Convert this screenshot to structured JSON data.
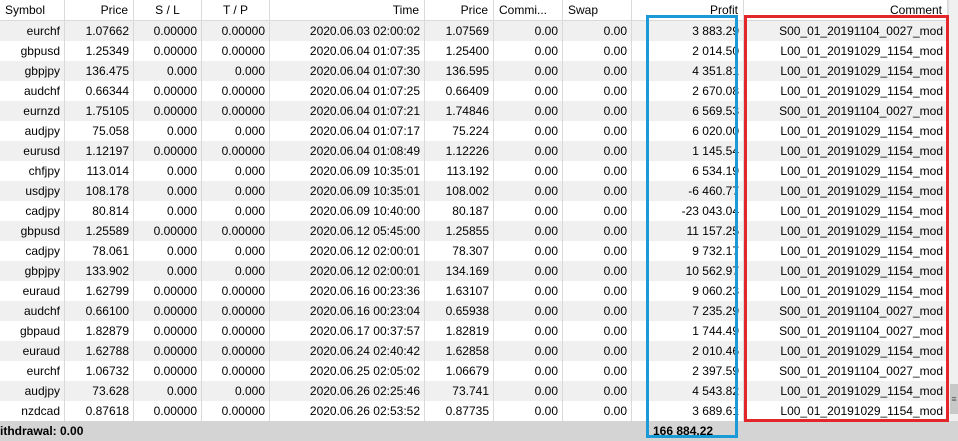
{
  "columns": [
    "Symbol",
    "Price",
    "S / L",
    "T / P",
    "Time",
    "Price",
    "Commi...",
    "Swap",
    "Profit",
    "Comment"
  ],
  "rows": [
    [
      "eurchf",
      "1.07662",
      "0.00000",
      "0.00000",
      "2020.06.03 02:00:02",
      "1.07569",
      "0.00",
      "0.00",
      "3 883.29",
      "S00_01_20191104_0027_mod"
    ],
    [
      "gbpusd",
      "1.25349",
      "0.00000",
      "0.00000",
      "2020.06.04 01:07:35",
      "1.25400",
      "0.00",
      "0.00",
      "2 014.50",
      "L00_01_20191029_1154_mod"
    ],
    [
      "gbpjpy",
      "136.475",
      "0.000",
      "0.000",
      "2020.06.04 01:07:30",
      "136.595",
      "0.00",
      "0.00",
      "4 351.81",
      "L00_01_20191029_1154_mod"
    ],
    [
      "audchf",
      "0.66344",
      "0.00000",
      "0.00000",
      "2020.06.04 01:07:25",
      "0.66409",
      "0.00",
      "0.00",
      "2 670.08",
      "L00_01_20191029_1154_mod"
    ],
    [
      "eurnzd",
      "1.75105",
      "0.00000",
      "0.00000",
      "2020.06.04 01:07:21",
      "1.74846",
      "0.00",
      "0.00",
      "6 569.53",
      "S00_01_20191104_0027_mod"
    ],
    [
      "audjpy",
      "75.058",
      "0.000",
      "0.000",
      "2020.06.04 01:07:17",
      "75.224",
      "0.00",
      "0.00",
      "6 020.00",
      "L00_01_20191029_1154_mod"
    ],
    [
      "eurusd",
      "1.12197",
      "0.00000",
      "0.00000",
      "2020.06.04 01:08:49",
      "1.12226",
      "0.00",
      "0.00",
      "1 145.54",
      "L00_01_20191029_1154_mod"
    ],
    [
      "chfjpy",
      "113.014",
      "0.000",
      "0.000",
      "2020.06.09 10:35:01",
      "113.192",
      "0.00",
      "0.00",
      "6 534.19",
      "L00_01_20191029_1154_mod"
    ],
    [
      "usdjpy",
      "108.178",
      "0.000",
      "0.000",
      "2020.06.09 10:35:01",
      "108.002",
      "0.00",
      "0.00",
      "-6 460.77",
      "L00_01_20191029_1154_mod"
    ],
    [
      "cadjpy",
      "80.814",
      "0.000",
      "0.000",
      "2020.06.09 10:40:00",
      "80.187",
      "0.00",
      "0.00",
      "-23 043.04",
      "L00_01_20191029_1154_mod"
    ],
    [
      "gbpusd",
      "1.25589",
      "0.00000",
      "0.00000",
      "2020.06.12 05:45:00",
      "1.25855",
      "0.00",
      "0.00",
      "11 157.25",
      "L00_01_20191029_1154_mod"
    ],
    [
      "cadjpy",
      "78.061",
      "0.000",
      "0.000",
      "2020.06.12 02:00:01",
      "78.307",
      "0.00",
      "0.00",
      "9 732.17",
      "L00_01_20191029_1154_mod"
    ],
    [
      "gbpjpy",
      "133.902",
      "0.000",
      "0.000",
      "2020.06.12 02:00:01",
      "134.169",
      "0.00",
      "0.00",
      "10 562.97",
      "L00_01_20191029_1154_mod"
    ],
    [
      "euraud",
      "1.62799",
      "0.00000",
      "0.00000",
      "2020.06.16 00:23:36",
      "1.63107",
      "0.00",
      "0.00",
      "9 060.23",
      "L00_01_20191029_1154_mod"
    ],
    [
      "audchf",
      "0.66100",
      "0.00000",
      "0.00000",
      "2020.06.16 00:23:04",
      "0.65938",
      "0.00",
      "0.00",
      "7 235.29",
      "S00_01_20191104_0027_mod"
    ],
    [
      "gbpaud",
      "1.82879",
      "0.00000",
      "0.00000",
      "2020.06.17 00:37:57",
      "1.82819",
      "0.00",
      "0.00",
      "1 744.49",
      "S00_01_20191104_0027_mod"
    ],
    [
      "euraud",
      "1.62788",
      "0.00000",
      "0.00000",
      "2020.06.24 02:40:42",
      "1.62858",
      "0.00",
      "0.00",
      "2 010.46",
      "L00_01_20191029_1154_mod"
    ],
    [
      "eurchf",
      "1.06732",
      "0.00000",
      "0.00000",
      "2020.06.25 02:05:02",
      "1.06679",
      "0.00",
      "0.00",
      "2 397.59",
      "S00_01_20191104_0027_mod"
    ],
    [
      "audjpy",
      "73.628",
      "0.000",
      "0.000",
      "2020.06.26 02:25:46",
      "73.741",
      "0.00",
      "0.00",
      "4 543.82",
      "L00_01_20191029_1154_mod"
    ],
    [
      "nzdcad",
      "0.87618",
      "0.00000",
      "0.00000",
      "2020.06.26 02:53:52",
      "0.87735",
      "0.00",
      "0.00",
      "3 689.61",
      "L00_01_20191029_1154_mod"
    ]
  ],
  "footer": {
    "label": "ithdrawal: 0.00",
    "total_profit": "166 884.22"
  },
  "scrollbar": {
    "thumb_icon": "≡"
  },
  "highlights": {
    "profit_color": "#1a9ad6",
    "comment_color": "#e3262a"
  }
}
